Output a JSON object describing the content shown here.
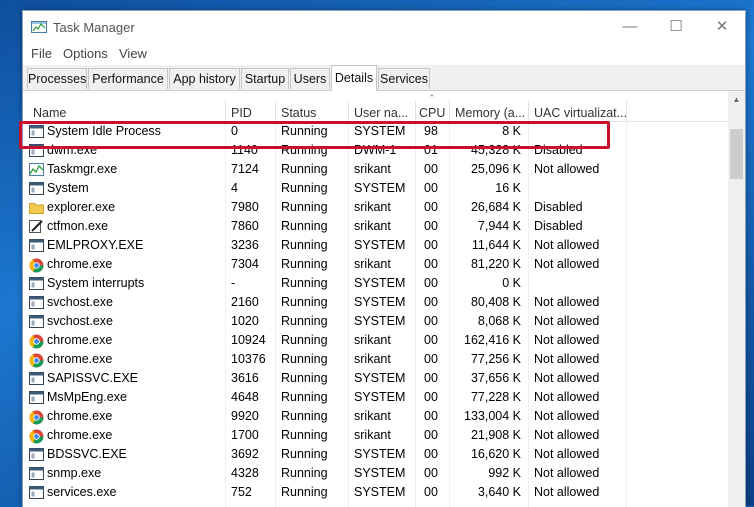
{
  "window": {
    "title": "Task Manager"
  },
  "window_controls": {
    "minimize": "—",
    "maximize": "☐",
    "close": "✕"
  },
  "menu": [
    "File",
    "Options",
    "View"
  ],
  "tabs": [
    "Processes",
    "Performance",
    "App history",
    "Startup",
    "Users",
    "Details",
    "Services"
  ],
  "active_tab": "Details",
  "columns": [
    "Name",
    "PID",
    "Status",
    "User na...",
    "CPU",
    "Memory (a...",
    "UAC virtualizat..."
  ],
  "rows": [
    {
      "name": "System Idle Process",
      "pid": "0",
      "status": "Running",
      "user": "SYSTEM",
      "cpu": "98",
      "mem": "8 K",
      "uac": "",
      "icon": "window-icon"
    },
    {
      "name": "dwm.exe",
      "pid": "1140",
      "status": "Running",
      "user": "DWM-1",
      "cpu": "01",
      "mem": "45,328 K",
      "uac": "Disabled",
      "icon": "window-icon"
    },
    {
      "name": "Taskmgr.exe",
      "pid": "7124",
      "status": "Running",
      "user": "srikant",
      "cpu": "00",
      "mem": "25,096 K",
      "uac": "Not allowed",
      "icon": "taskmgr-icon"
    },
    {
      "name": "System",
      "pid": "4",
      "status": "Running",
      "user": "SYSTEM",
      "cpu": "00",
      "mem": "16 K",
      "uac": "",
      "icon": "window-icon"
    },
    {
      "name": "explorer.exe",
      "pid": "7980",
      "status": "Running",
      "user": "srikant",
      "cpu": "00",
      "mem": "26,684 K",
      "uac": "Disabled",
      "icon": "folder-icon"
    },
    {
      "name": "ctfmon.exe",
      "pid": "7860",
      "status": "Running",
      "user": "srikant",
      "cpu": "00",
      "mem": "7,944 K",
      "uac": "Disabled",
      "icon": "pen-icon"
    },
    {
      "name": "EMLPROXY.EXE",
      "pid": "3236",
      "status": "Running",
      "user": "SYSTEM",
      "cpu": "00",
      "mem": "11,644 K",
      "uac": "Not allowed",
      "icon": "window-icon"
    },
    {
      "name": "chrome.exe",
      "pid": "7304",
      "status": "Running",
      "user": "srikant",
      "cpu": "00",
      "mem": "81,220 K",
      "uac": "Not allowed",
      "icon": "chrome-icon"
    },
    {
      "name": "System interrupts",
      "pid": "-",
      "status": "Running",
      "user": "SYSTEM",
      "cpu": "00",
      "mem": "0 K",
      "uac": "",
      "icon": "window-icon"
    },
    {
      "name": "svchost.exe",
      "pid": "2160",
      "status": "Running",
      "user": "SYSTEM",
      "cpu": "00",
      "mem": "80,408 K",
      "uac": "Not allowed",
      "icon": "window-icon"
    },
    {
      "name": "svchost.exe",
      "pid": "1020",
      "status": "Running",
      "user": "SYSTEM",
      "cpu": "00",
      "mem": "8,068 K",
      "uac": "Not allowed",
      "icon": "window-icon"
    },
    {
      "name": "chrome.exe",
      "pid": "10924",
      "status": "Running",
      "user": "srikant",
      "cpu": "00",
      "mem": "162,416 K",
      "uac": "Not allowed",
      "icon": "chrome-icon"
    },
    {
      "name": "chrome.exe",
      "pid": "10376",
      "status": "Running",
      "user": "srikant",
      "cpu": "00",
      "mem": "77,256 K",
      "uac": "Not allowed",
      "icon": "chrome-icon"
    },
    {
      "name": "SAPISSVC.EXE",
      "pid": "3616",
      "status": "Running",
      "user": "SYSTEM",
      "cpu": "00",
      "mem": "37,656 K",
      "uac": "Not allowed",
      "icon": "window-icon"
    },
    {
      "name": "MsMpEng.exe",
      "pid": "4648",
      "status": "Running",
      "user": "SYSTEM",
      "cpu": "00",
      "mem": "77,228 K",
      "uac": "Not allowed",
      "icon": "window-icon"
    },
    {
      "name": "chrome.exe",
      "pid": "9920",
      "status": "Running",
      "user": "srikant",
      "cpu": "00",
      "mem": "133,004 K",
      "uac": "Not allowed",
      "icon": "chrome-icon"
    },
    {
      "name": "chrome.exe",
      "pid": "1700",
      "status": "Running",
      "user": "srikant",
      "cpu": "00",
      "mem": "21,908 K",
      "uac": "Not allowed",
      "icon": "chrome-icon"
    },
    {
      "name": "BDSSVC.EXE",
      "pid": "3692",
      "status": "Running",
      "user": "SYSTEM",
      "cpu": "00",
      "mem": "16,620 K",
      "uac": "Not allowed",
      "icon": "window-icon"
    },
    {
      "name": "snmp.exe",
      "pid": "4328",
      "status": "Running",
      "user": "SYSTEM",
      "cpu": "00",
      "mem": "992 K",
      "uac": "Not allowed",
      "icon": "window-icon"
    },
    {
      "name": "services.exe",
      "pid": "752",
      "status": "Running",
      "user": "SYSTEM",
      "cpu": "00",
      "mem": "3,640 K",
      "uac": "Not allowed",
      "icon": "window-icon"
    }
  ],
  "colors": {
    "highlight": "#c8102e",
    "accent": "#1565b8"
  }
}
